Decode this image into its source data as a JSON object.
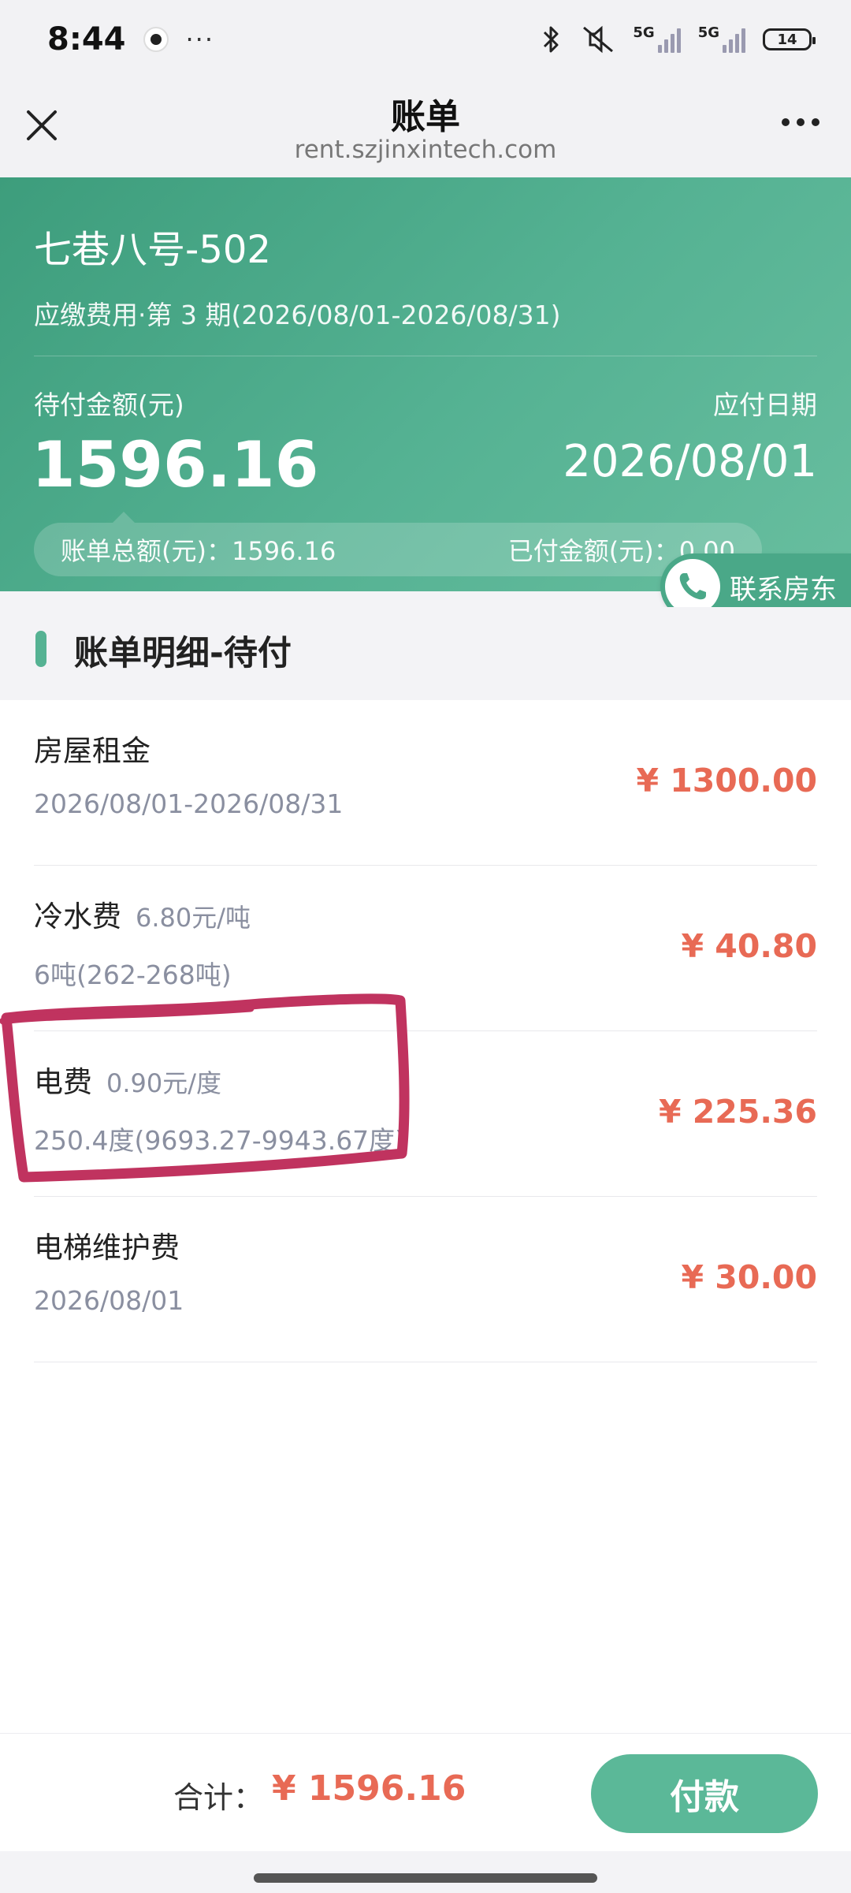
{
  "status_bar": {
    "time": "8:44",
    "network1": "5G",
    "network2": "5G",
    "battery": "14",
    "icons": [
      "record-icon",
      "bluetooth-icon",
      "mute-icon",
      "signal-icon",
      "battery-icon"
    ]
  },
  "nav": {
    "title": "账单",
    "url": "rent.szjinxintech.com"
  },
  "hero": {
    "property": "七巷八号-502",
    "period": "应缴费用·第 3 期(2026/08/01-2026/08/31)",
    "pending_label": "待付金额(元)",
    "pending_amount": "1596.16",
    "due_label": "应付日期",
    "due_date": "2026/08/01",
    "total_label": "账单总额(元)：1596.16",
    "paid_label": "已付金额(元)：0.00"
  },
  "contact": {
    "label": "联系房东"
  },
  "section": {
    "title": "账单明细-待付"
  },
  "bills": [
    {
      "name": "房屋租金",
      "rate": "",
      "detail": "2026/08/01-2026/08/31",
      "amount": "¥ 1300.00"
    },
    {
      "name": "冷水费",
      "rate": "6.80元/吨",
      "detail": "6吨(262-268吨)",
      "amount": "¥ 40.80"
    },
    {
      "name": "电费",
      "rate": "0.90元/度",
      "detail": "250.4度(9693.27-9943.67度)",
      "amount": "¥ 225.36"
    },
    {
      "name": "电梯维护费",
      "rate": "",
      "detail": "2026/08/01",
      "amount": "¥ 30.00"
    }
  ],
  "bottom": {
    "total_label": "合计：",
    "total_amount": "¥ 1596.16",
    "pay_label": "付款"
  },
  "colors": {
    "brand": "#55b293",
    "amount": "#e86a55",
    "annotation": "#c0335f"
  }
}
